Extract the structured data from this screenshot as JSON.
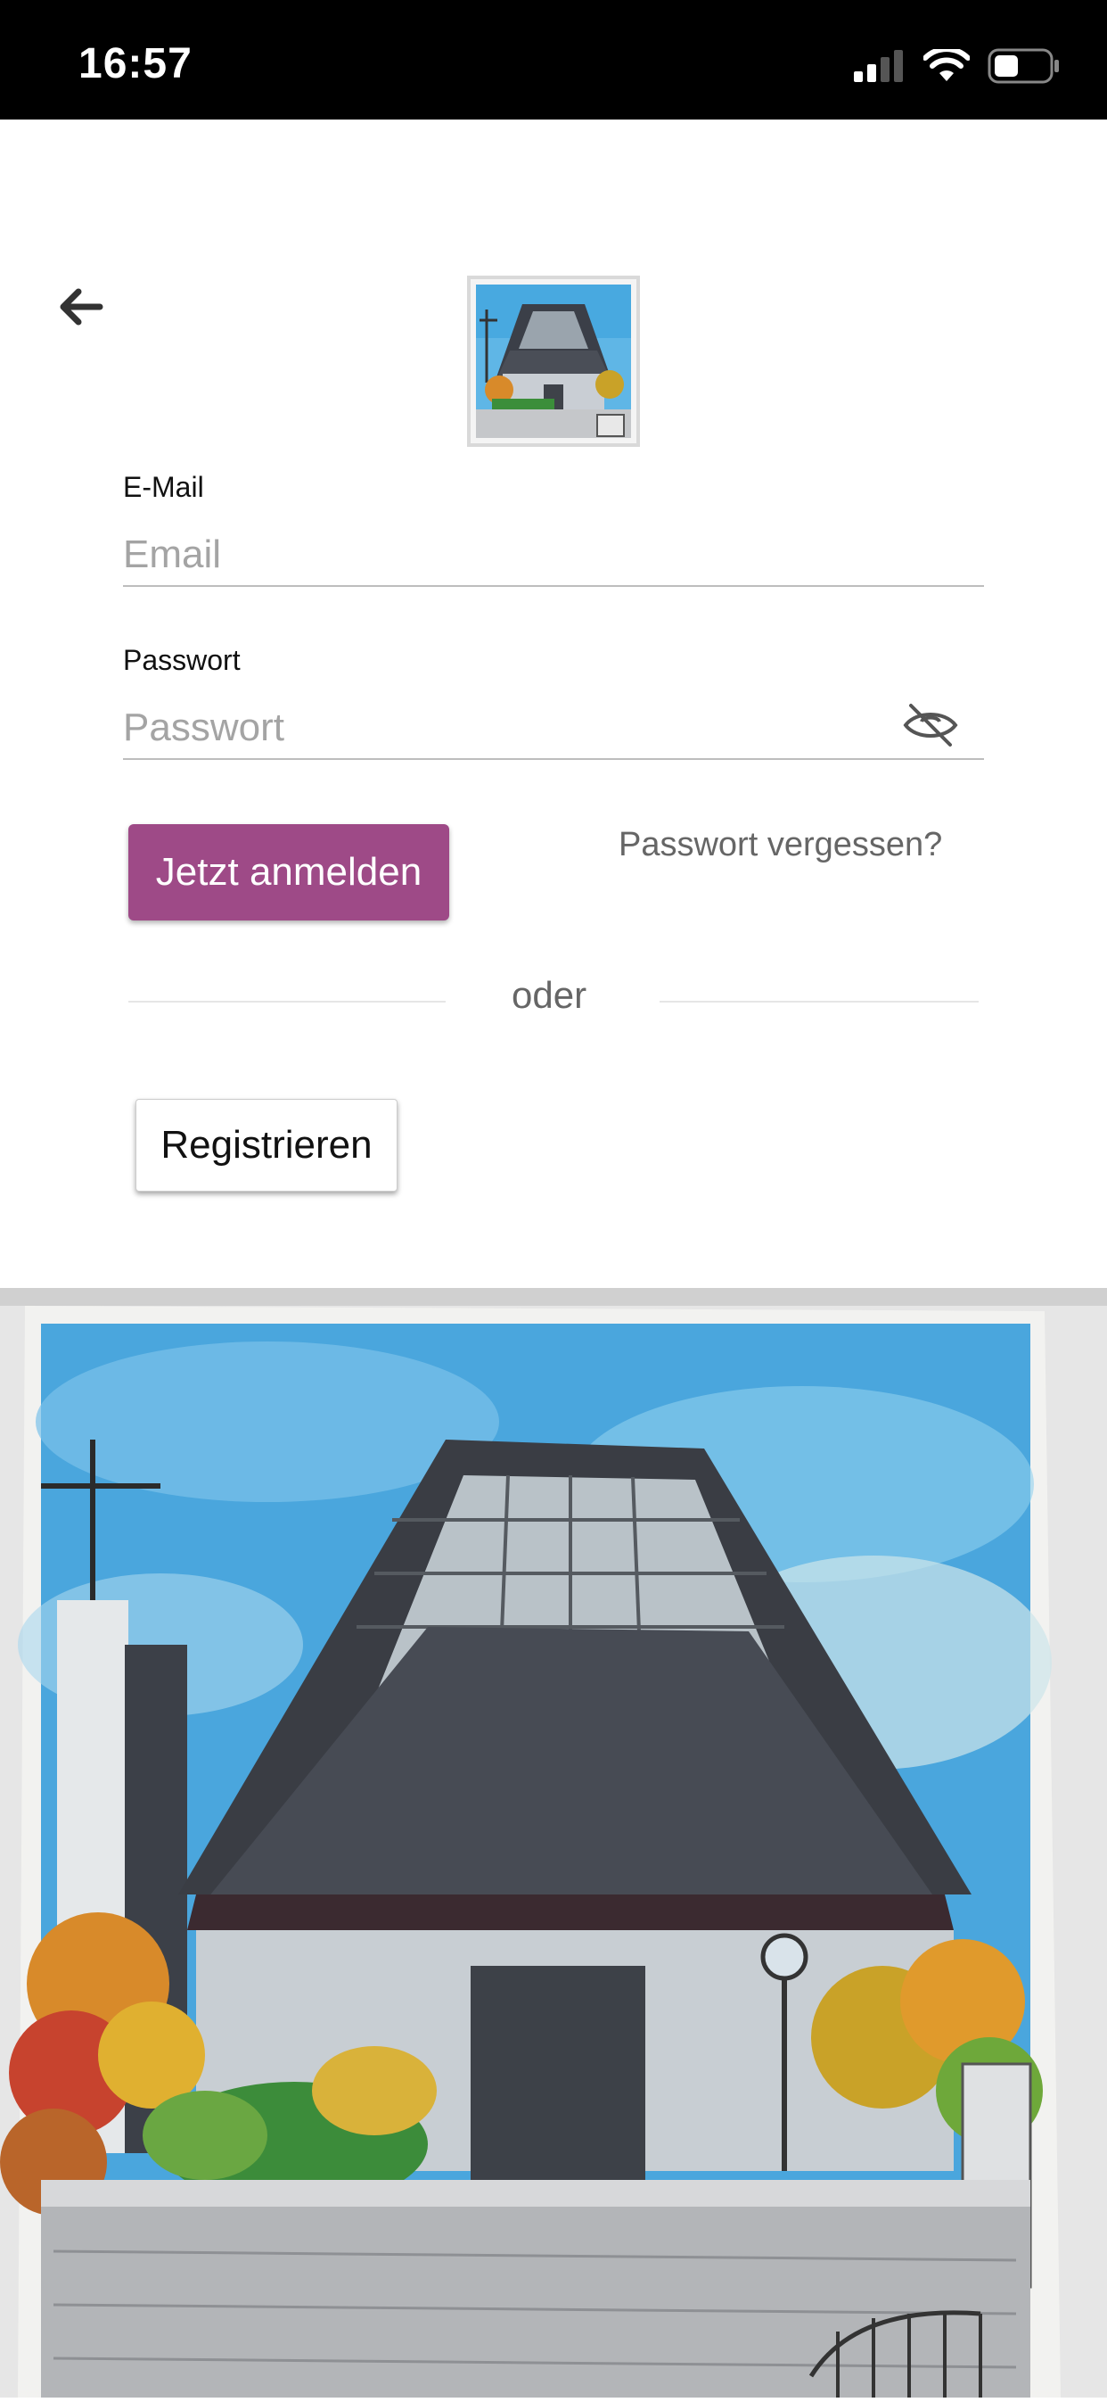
{
  "status_bar": {
    "time": "16:57"
  },
  "form": {
    "email_label": "E-Mail",
    "email_placeholder": "Email",
    "email_value": "",
    "password_label": "Passwort",
    "password_placeholder": "Passwort",
    "password_value": ""
  },
  "actions": {
    "login_label": "Jetzt anmelden",
    "forgot_label": "Passwort vergessen?",
    "divider_label": "oder",
    "register_label": "Registrieren"
  },
  "colors": {
    "accent": "#9e4a87",
    "status_bar_bg": "#000000"
  },
  "icons": {
    "back": "arrow-left-icon",
    "password_visibility": "eye-off-icon",
    "signal": "cellular-signal-icon",
    "wifi": "wifi-icon",
    "battery": "battery-icon"
  }
}
